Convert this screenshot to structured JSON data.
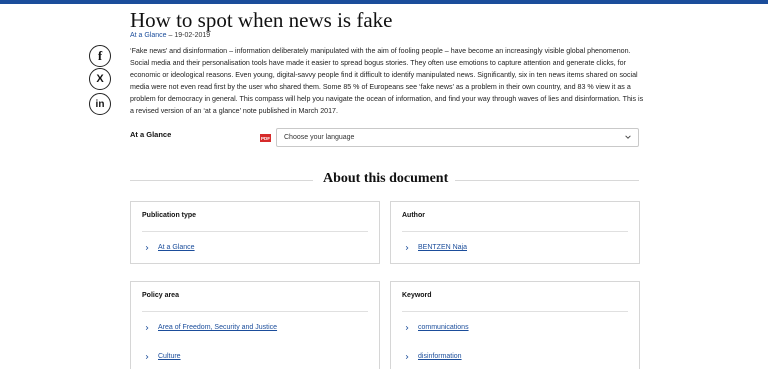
{
  "article": {
    "title": "How to spot when news is fake",
    "type_link": "At a Glance",
    "date": "– 19-02-2019",
    "abstract": "‘Fake news’ and disinformation – information deliberately manipulated with the aim of fooling people – have become an increasingly visible global phenomenon. Social media and their personalisation tools have made it easier to spread bogus stories. They often use emotions to capture attention and generate clicks, for economic or ideological reasons. Even young, digital-savvy people find it difficult to identify manipulated news. Significantly, six in ten news items shared on social media were not even read first by the user who shared them. Some 85 % of Europeans see ‘fake news’ as a problem in their own country, and 83 % view it as a problem for democracy in general. This compass will help you navigate the ocean of information, and find your way through waves of lies and disinformation. This is a revised version of an ‘at a glance’ note published in March 2017."
  },
  "social": {
    "facebook": "f",
    "x": "X",
    "linkedin": "in"
  },
  "glance": {
    "label": "At a Glance",
    "pdf_badge": "PDF",
    "language_placeholder": "Choose your language"
  },
  "about": {
    "title": "About this document",
    "publication_type": {
      "heading": "Publication type",
      "items": [
        "At a Glance"
      ]
    },
    "author": {
      "heading": "Author",
      "items": [
        "BENTZEN Naja"
      ]
    },
    "policy_area": {
      "heading": "Policy area",
      "items": [
        "Area of Freedom, Security and Justice",
        "Culture"
      ]
    },
    "keyword": {
      "heading": "Keyword",
      "items": [
        "communications",
        "disinformation"
      ]
    }
  },
  "colors": {
    "link": "#1b4d9b",
    "topbar": "#1b4d9b",
    "pdf": "#d62b2b"
  }
}
